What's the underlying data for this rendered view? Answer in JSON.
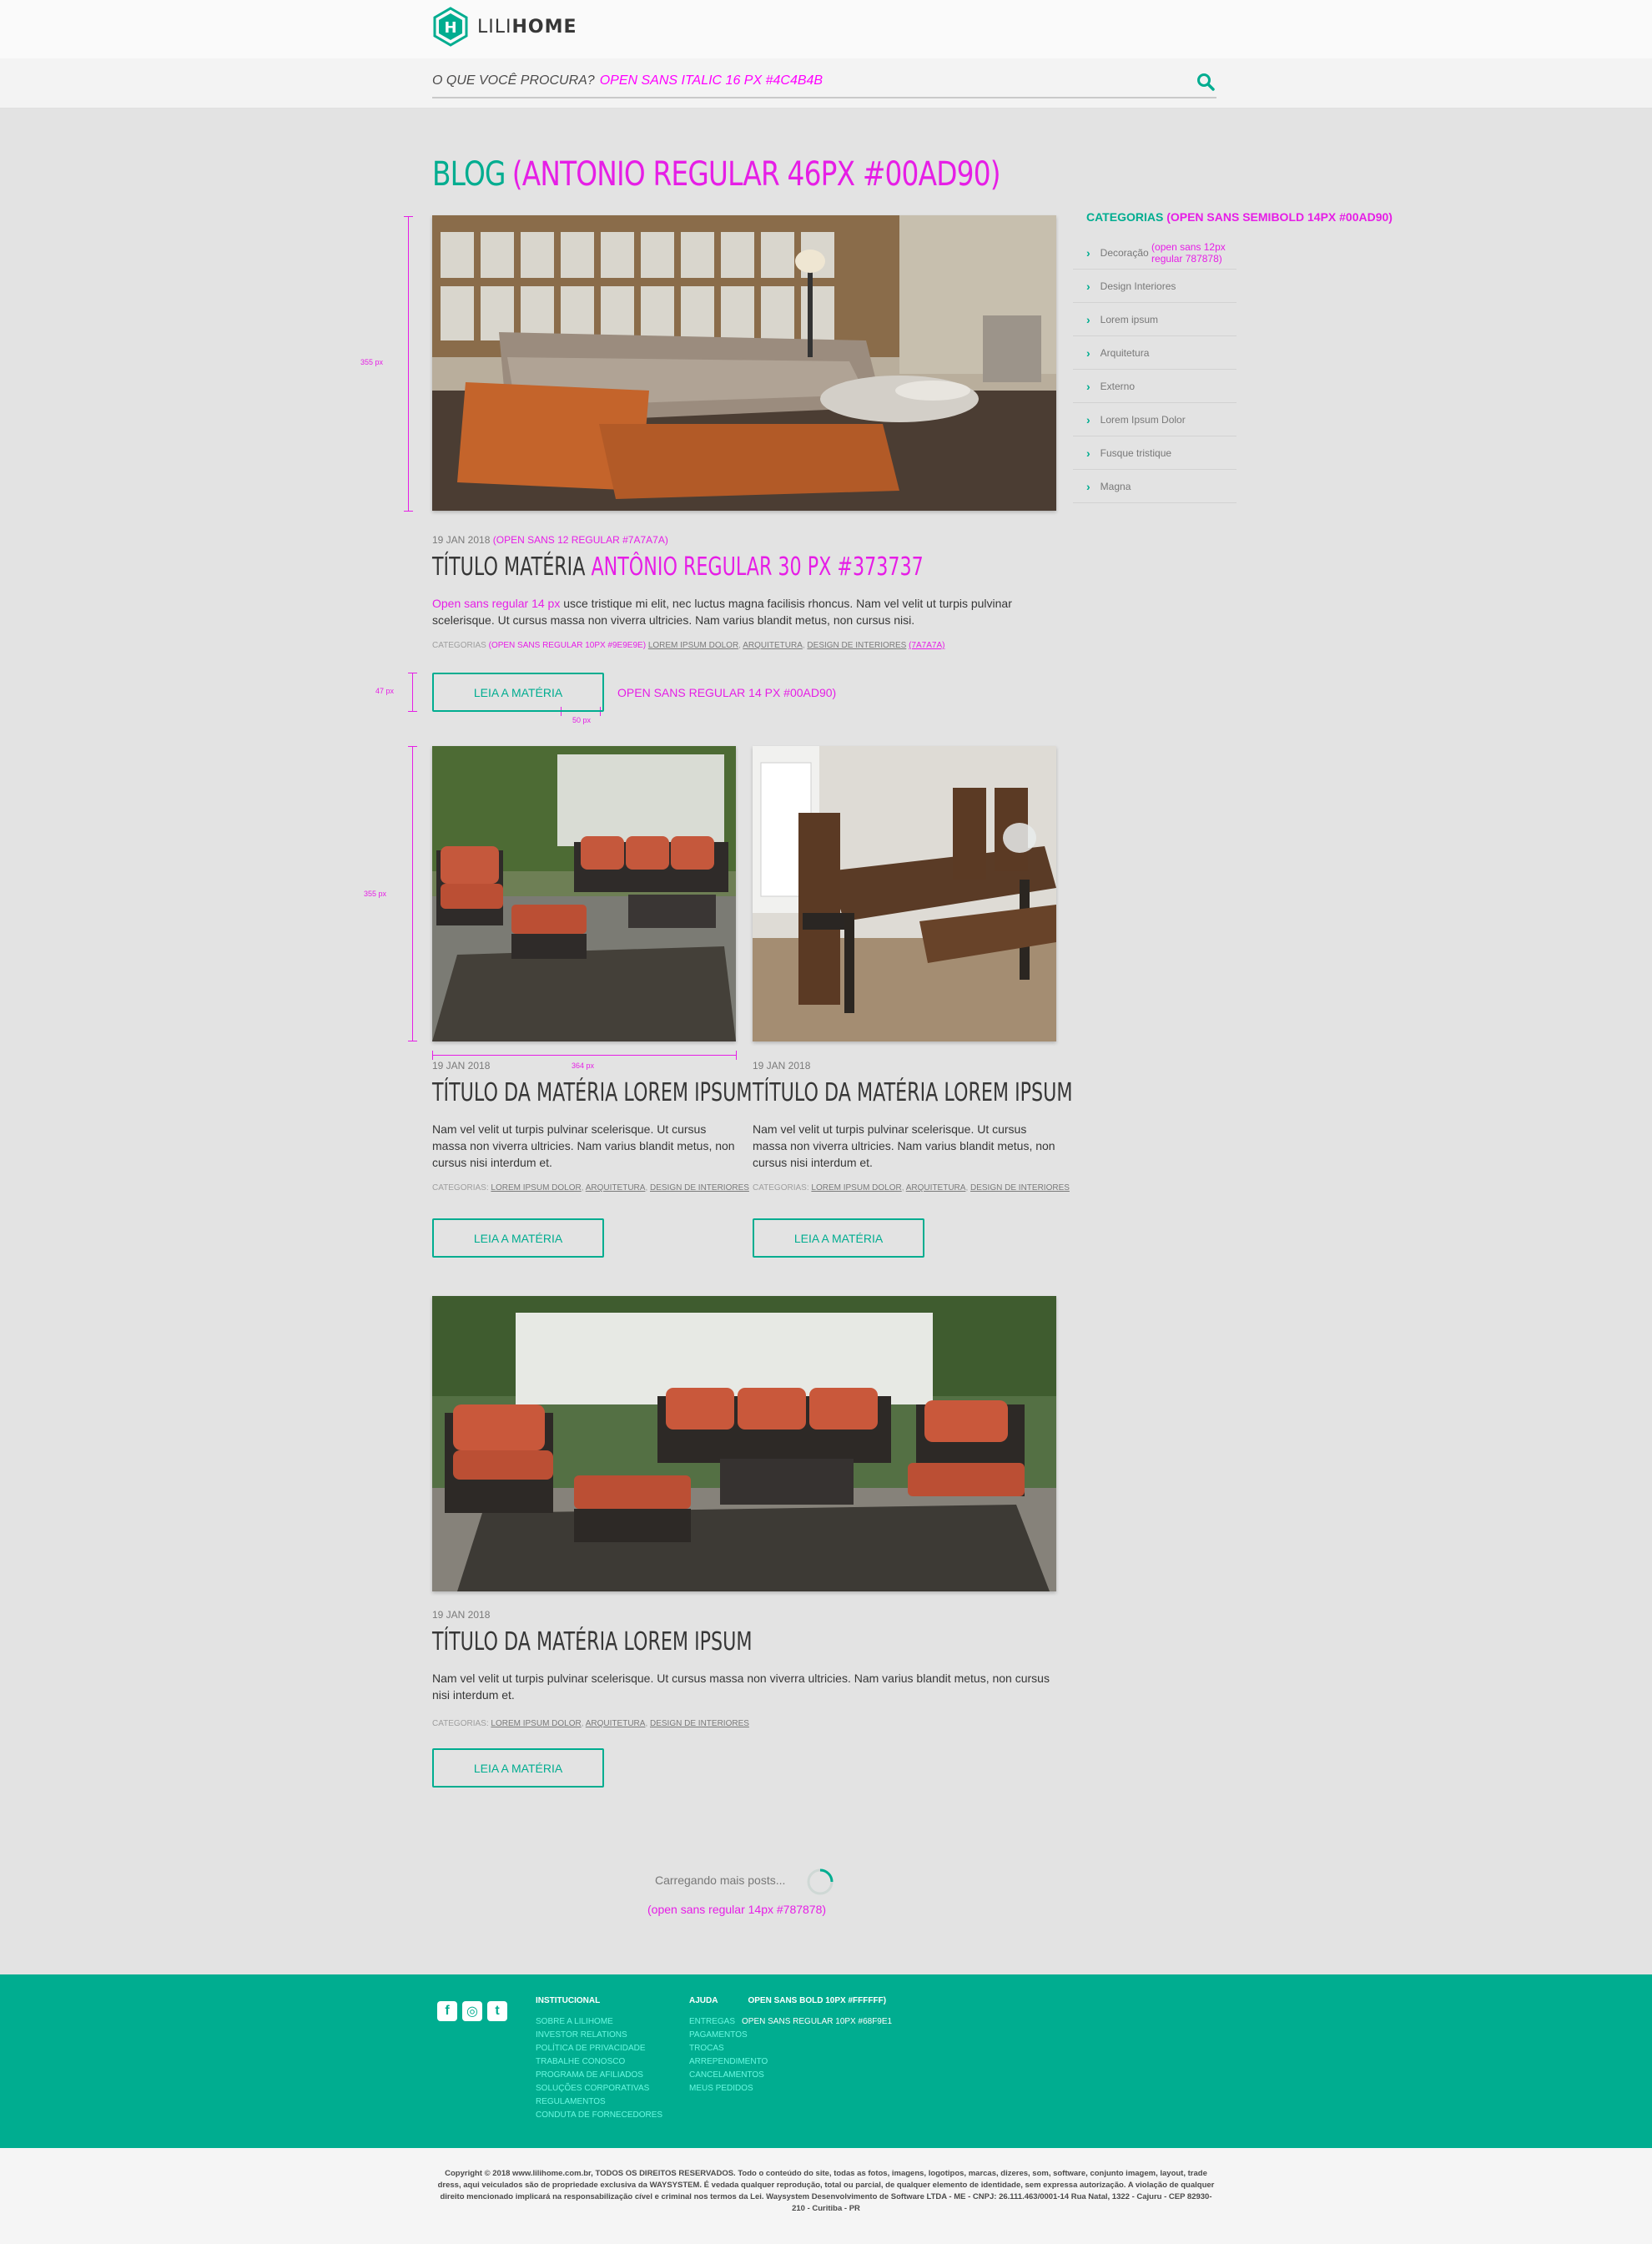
{
  "brand": {
    "name_light": "LILI",
    "name_bold": "HOME",
    "accent": "#00ad90",
    "note_color": "#e61ee6"
  },
  "search": {
    "placeholder": "O QUE VOCÊ PROCURA?",
    "note": "OPEN SANS ITALIC 16 PX #4C4B4B",
    "icon": "search-icon"
  },
  "blog": {
    "title": "BLOG",
    "title_note": "(ANTONIO REGULAR 46PX #00AD90)"
  },
  "dims": {
    "img_h": "355 px",
    "btn_h": "47 px",
    "btn_gap": "50 px",
    "col_w": "364 px"
  },
  "featured": {
    "date": "19 JAN 2018",
    "date_note": "(OPEN SANS 12 REGULAR #7A7A7A)",
    "title": "TÍTULO MATÉRIA",
    "title_note": "ANTÔNIO REGULAR 30 PX #373737",
    "excerpt_note": "Open sans regular 14 px",
    "excerpt": " usce tristique mi elit, nec luctus magna facilisis rhoncus. Nam vel velit ut turpis pulvinar scelerisque. Ut cursus massa non viverra ultricies. Nam varius blandit metus, non cursus nisi.",
    "cats_label": "CATEGORIAS",
    "cats_note": "(OPEN SANS REGULAR 10PX #9E9E9E)",
    "cats": [
      "LOREM IPSUM DOLOR",
      "ARQUITETURA",
      "DESIGN DE INTERIORES"
    ],
    "cats_note2": "(7A7A7A)",
    "button": "LEIA A MATÉRIA",
    "button_note": "OPEN SANS REGULAR 14 PX #00AD90)"
  },
  "posts": [
    {
      "date": "19 JAN 2018",
      "title": "TÍTULO DA MATÉRIA LOREM IPSUM",
      "excerpt": "Nam vel velit ut turpis pulvinar scelerisque. Ut cursus massa non viverra ultricies. Nam varius blandit metus, non cursus nisi interdum et.",
      "cats_label": "CATEGORIAS:",
      "cats": [
        "LOREM IPSUM DOLOR",
        "ARQUITETURA",
        "DESIGN DE INTERIORES"
      ],
      "button": "LEIA A MATÉRIA"
    },
    {
      "date": "19 JAN 2018",
      "title": "TÍTULO DA MATÉRIA LOREM IPSUM",
      "excerpt": "Nam vel velit ut turpis pulvinar scelerisque. Ut cursus massa non viverra ultricies. Nam varius blandit metus, non cursus nisi interdum et.",
      "cats_label": "CATEGORIAS:",
      "cats": [
        "LOREM IPSUM DOLOR",
        "ARQUITETURA",
        "DESIGN DE INTERIORES"
      ],
      "button": "LEIA A MATÉRIA"
    },
    {
      "date": "19 JAN 2018",
      "title": "TÍTULO DA MATÉRIA LOREM IPSUM",
      "excerpt": "Nam vel velit ut turpis pulvinar scelerisque. Ut cursus massa non viverra ultricies. Nam varius blandit metus, non cursus nisi interdum et.",
      "cats_label": "CATEGORIAS:",
      "cats": [
        "LOREM IPSUM DOLOR",
        "ARQUITETURA",
        "DESIGN DE INTERIORES"
      ],
      "button": "LEIA A MATÉRIA"
    }
  ],
  "sidebar": {
    "title": "CATEGORIAS",
    "title_note": "(OPEN SANS SEMIBOLD 14PX  #00AD90)",
    "items": [
      {
        "label": "Decoração",
        "note": "(open sans 12px regular 787878)"
      },
      {
        "label": "Design Interiores"
      },
      {
        "label": "Lorem ipsum"
      },
      {
        "label": "Arquitetura"
      },
      {
        "label": "Externo"
      },
      {
        "label": "Lorem Ipsum Dolor"
      },
      {
        "label": "Fusque tristique"
      },
      {
        "label": "Magna"
      }
    ]
  },
  "loading": {
    "text": "Carregando mais posts...",
    "note": "(open sans regular 14px #787878)"
  },
  "footer": {
    "social": [
      "f",
      "◎",
      "t"
    ],
    "institucional": {
      "title": "INSTITUCIONAL",
      "links": [
        "SOBRE A LILIHOME",
        "INVESTOR RELATIONS",
        "POLÍTICA DE PRIVACIDADE",
        "TRABALHE CONOSCO",
        "PROGRAMA DE AFILIADOS",
        "SOLUÇÕES CORPORATIVAS",
        "REGULAMENTOS",
        "CONDUTA DE FORNECEDORES"
      ]
    },
    "ajuda": {
      "title": "AJUDA",
      "title_note": "OPEN SANS BOLD 10PX #FFFFFF)",
      "first_note": "OPEN SANS REGULAR 10PX #68F9E1",
      "links": [
        "ENTREGAS",
        "PAGAMENTOS",
        "TROCAS",
        "ARREPENDIMENTO",
        "CANCELAMENTOS",
        "MEUS PEDIDOS"
      ]
    },
    "copyright": "Copyright © 2018 www.lilihome.com.br, TODOS OS DIREITOS RESERVADOS. Todo o conteúdo do site, todas as fotos, imagens, logotipos, marcas, dizeres, som, software, conjunto imagem, layout, trade dress, aqui veiculados são de propriedade exclusiva da WAYSYSTEM. É vedada qualquer reprodução, total ou parcial, de qualquer elemento de identidade, sem expressa autorização. A violação de qualquer direito mencionado implicará na responsabilização cível e criminal nos termos da Lei. Waysystem Desenvolvimento de Software LTDA - ME - CNPJ: 26.111.463/0001-14 Rua Natal, 1322 - Cajuru - CEP 82930-210 - Curitiba - PR"
  }
}
